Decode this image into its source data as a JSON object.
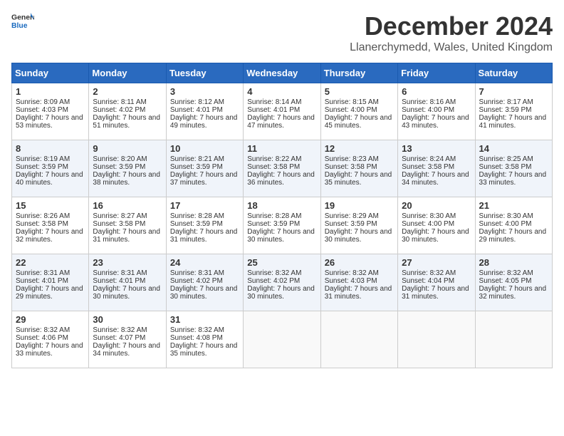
{
  "header": {
    "logo_general": "General",
    "logo_blue": "Blue",
    "title": "December 2024",
    "location": "Llanerchymedd, Wales, United Kingdom"
  },
  "calendar": {
    "weekdays": [
      "Sunday",
      "Monday",
      "Tuesday",
      "Wednesday",
      "Thursday",
      "Friday",
      "Saturday"
    ],
    "weeks": [
      [
        null,
        null,
        null,
        null,
        null,
        null,
        null
      ]
    ],
    "days": {
      "1": {
        "day": 1,
        "sunrise": "8:09 AM",
        "sunset": "4:03 PM",
        "daylight": "7 hours and 53 minutes."
      },
      "2": {
        "day": 2,
        "sunrise": "8:11 AM",
        "sunset": "4:02 PM",
        "daylight": "7 hours and 51 minutes."
      },
      "3": {
        "day": 3,
        "sunrise": "8:12 AM",
        "sunset": "4:01 PM",
        "daylight": "7 hours and 49 minutes."
      },
      "4": {
        "day": 4,
        "sunrise": "8:14 AM",
        "sunset": "4:01 PM",
        "daylight": "7 hours and 47 minutes."
      },
      "5": {
        "day": 5,
        "sunrise": "8:15 AM",
        "sunset": "4:00 PM",
        "daylight": "7 hours and 45 minutes."
      },
      "6": {
        "day": 6,
        "sunrise": "8:16 AM",
        "sunset": "4:00 PM",
        "daylight": "7 hours and 43 minutes."
      },
      "7": {
        "day": 7,
        "sunrise": "8:17 AM",
        "sunset": "3:59 PM",
        "daylight": "7 hours and 41 minutes."
      },
      "8": {
        "day": 8,
        "sunrise": "8:19 AM",
        "sunset": "3:59 PM",
        "daylight": "7 hours and 40 minutes."
      },
      "9": {
        "day": 9,
        "sunrise": "8:20 AM",
        "sunset": "3:59 PM",
        "daylight": "7 hours and 38 minutes."
      },
      "10": {
        "day": 10,
        "sunrise": "8:21 AM",
        "sunset": "3:59 PM",
        "daylight": "7 hours and 37 minutes."
      },
      "11": {
        "day": 11,
        "sunrise": "8:22 AM",
        "sunset": "3:58 PM",
        "daylight": "7 hours and 36 minutes."
      },
      "12": {
        "day": 12,
        "sunrise": "8:23 AM",
        "sunset": "3:58 PM",
        "daylight": "7 hours and 35 minutes."
      },
      "13": {
        "day": 13,
        "sunrise": "8:24 AM",
        "sunset": "3:58 PM",
        "daylight": "7 hours and 34 minutes."
      },
      "14": {
        "day": 14,
        "sunrise": "8:25 AM",
        "sunset": "3:58 PM",
        "daylight": "7 hours and 33 minutes."
      },
      "15": {
        "day": 15,
        "sunrise": "8:26 AM",
        "sunset": "3:58 PM",
        "daylight": "7 hours and 32 minutes."
      },
      "16": {
        "day": 16,
        "sunrise": "8:27 AM",
        "sunset": "3:58 PM",
        "daylight": "7 hours and 31 minutes."
      },
      "17": {
        "day": 17,
        "sunrise": "8:28 AM",
        "sunset": "3:59 PM",
        "daylight": "7 hours and 31 minutes."
      },
      "18": {
        "day": 18,
        "sunrise": "8:28 AM",
        "sunset": "3:59 PM",
        "daylight": "7 hours and 30 minutes."
      },
      "19": {
        "day": 19,
        "sunrise": "8:29 AM",
        "sunset": "3:59 PM",
        "daylight": "7 hours and 30 minutes."
      },
      "20": {
        "day": 20,
        "sunrise": "8:30 AM",
        "sunset": "4:00 PM",
        "daylight": "7 hours and 30 minutes."
      },
      "21": {
        "day": 21,
        "sunrise": "8:30 AM",
        "sunset": "4:00 PM",
        "daylight": "7 hours and 29 minutes."
      },
      "22": {
        "day": 22,
        "sunrise": "8:31 AM",
        "sunset": "4:01 PM",
        "daylight": "7 hours and 29 minutes."
      },
      "23": {
        "day": 23,
        "sunrise": "8:31 AM",
        "sunset": "4:01 PM",
        "daylight": "7 hours and 30 minutes."
      },
      "24": {
        "day": 24,
        "sunrise": "8:31 AM",
        "sunset": "4:02 PM",
        "daylight": "7 hours and 30 minutes."
      },
      "25": {
        "day": 25,
        "sunrise": "8:32 AM",
        "sunset": "4:02 PM",
        "daylight": "7 hours and 30 minutes."
      },
      "26": {
        "day": 26,
        "sunrise": "8:32 AM",
        "sunset": "4:03 PM",
        "daylight": "7 hours and 31 minutes."
      },
      "27": {
        "day": 27,
        "sunrise": "8:32 AM",
        "sunset": "4:04 PM",
        "daylight": "7 hours and 31 minutes."
      },
      "28": {
        "day": 28,
        "sunrise": "8:32 AM",
        "sunset": "4:05 PM",
        "daylight": "7 hours and 32 minutes."
      },
      "29": {
        "day": 29,
        "sunrise": "8:32 AM",
        "sunset": "4:06 PM",
        "daylight": "7 hours and 33 minutes."
      },
      "30": {
        "day": 30,
        "sunrise": "8:32 AM",
        "sunset": "4:07 PM",
        "daylight": "7 hours and 34 minutes."
      },
      "31": {
        "day": 31,
        "sunrise": "8:32 AM",
        "sunset": "4:08 PM",
        "daylight": "7 hours and 35 minutes."
      }
    }
  }
}
